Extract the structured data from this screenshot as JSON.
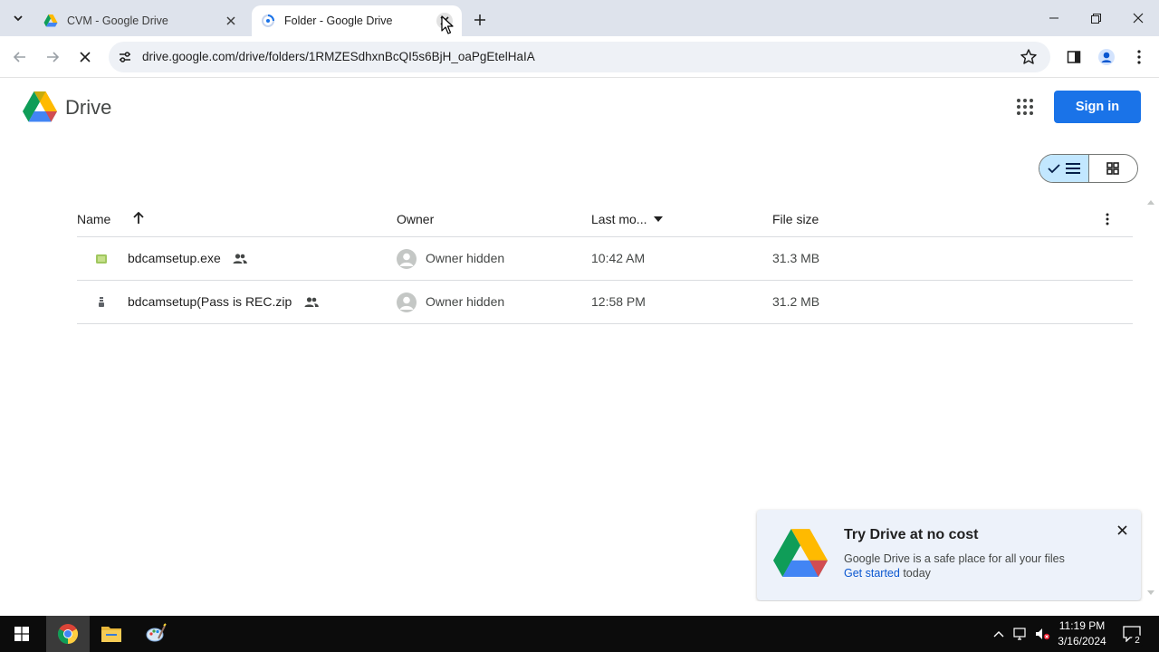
{
  "browser": {
    "tabs": [
      {
        "title": "CVM - Google Drive",
        "active": false
      },
      {
        "title": "Folder - Google Drive",
        "active": true
      }
    ],
    "url": "drive.google.com/drive/folders/1RMZESdhxnBcQI5s6BjH_oaPgEtelHaIA"
  },
  "drive": {
    "brand": "Drive",
    "sign_in_label": "Sign in",
    "columns": {
      "name": "Name",
      "owner": "Owner",
      "last_modified": "Last mo...",
      "file_size": "File size"
    },
    "files": [
      {
        "name": "bdcamsetup.exe",
        "owner": "Owner hidden",
        "modified": "10:42 AM",
        "size": "31.3 MB",
        "type": "exe"
      },
      {
        "name": "bdcamsetup(Pass is REC.zip",
        "owner": "Owner hidden",
        "modified": "12:58 PM",
        "size": "31.2 MB",
        "type": "zip"
      }
    ],
    "promo": {
      "title": "Try Drive at no cost",
      "body": "Google Drive is a safe place for all your files",
      "link": "Get started",
      "suffix": " today"
    }
  },
  "taskbar": {
    "time": "11:19 PM",
    "date": "3/16/2024",
    "notifications": "2"
  },
  "colors": {
    "accent": "#1a73e8",
    "tabbar": "#dee3ec",
    "toggle_on": "#c2e7ff",
    "promo_bg": "#edf2fa"
  }
}
